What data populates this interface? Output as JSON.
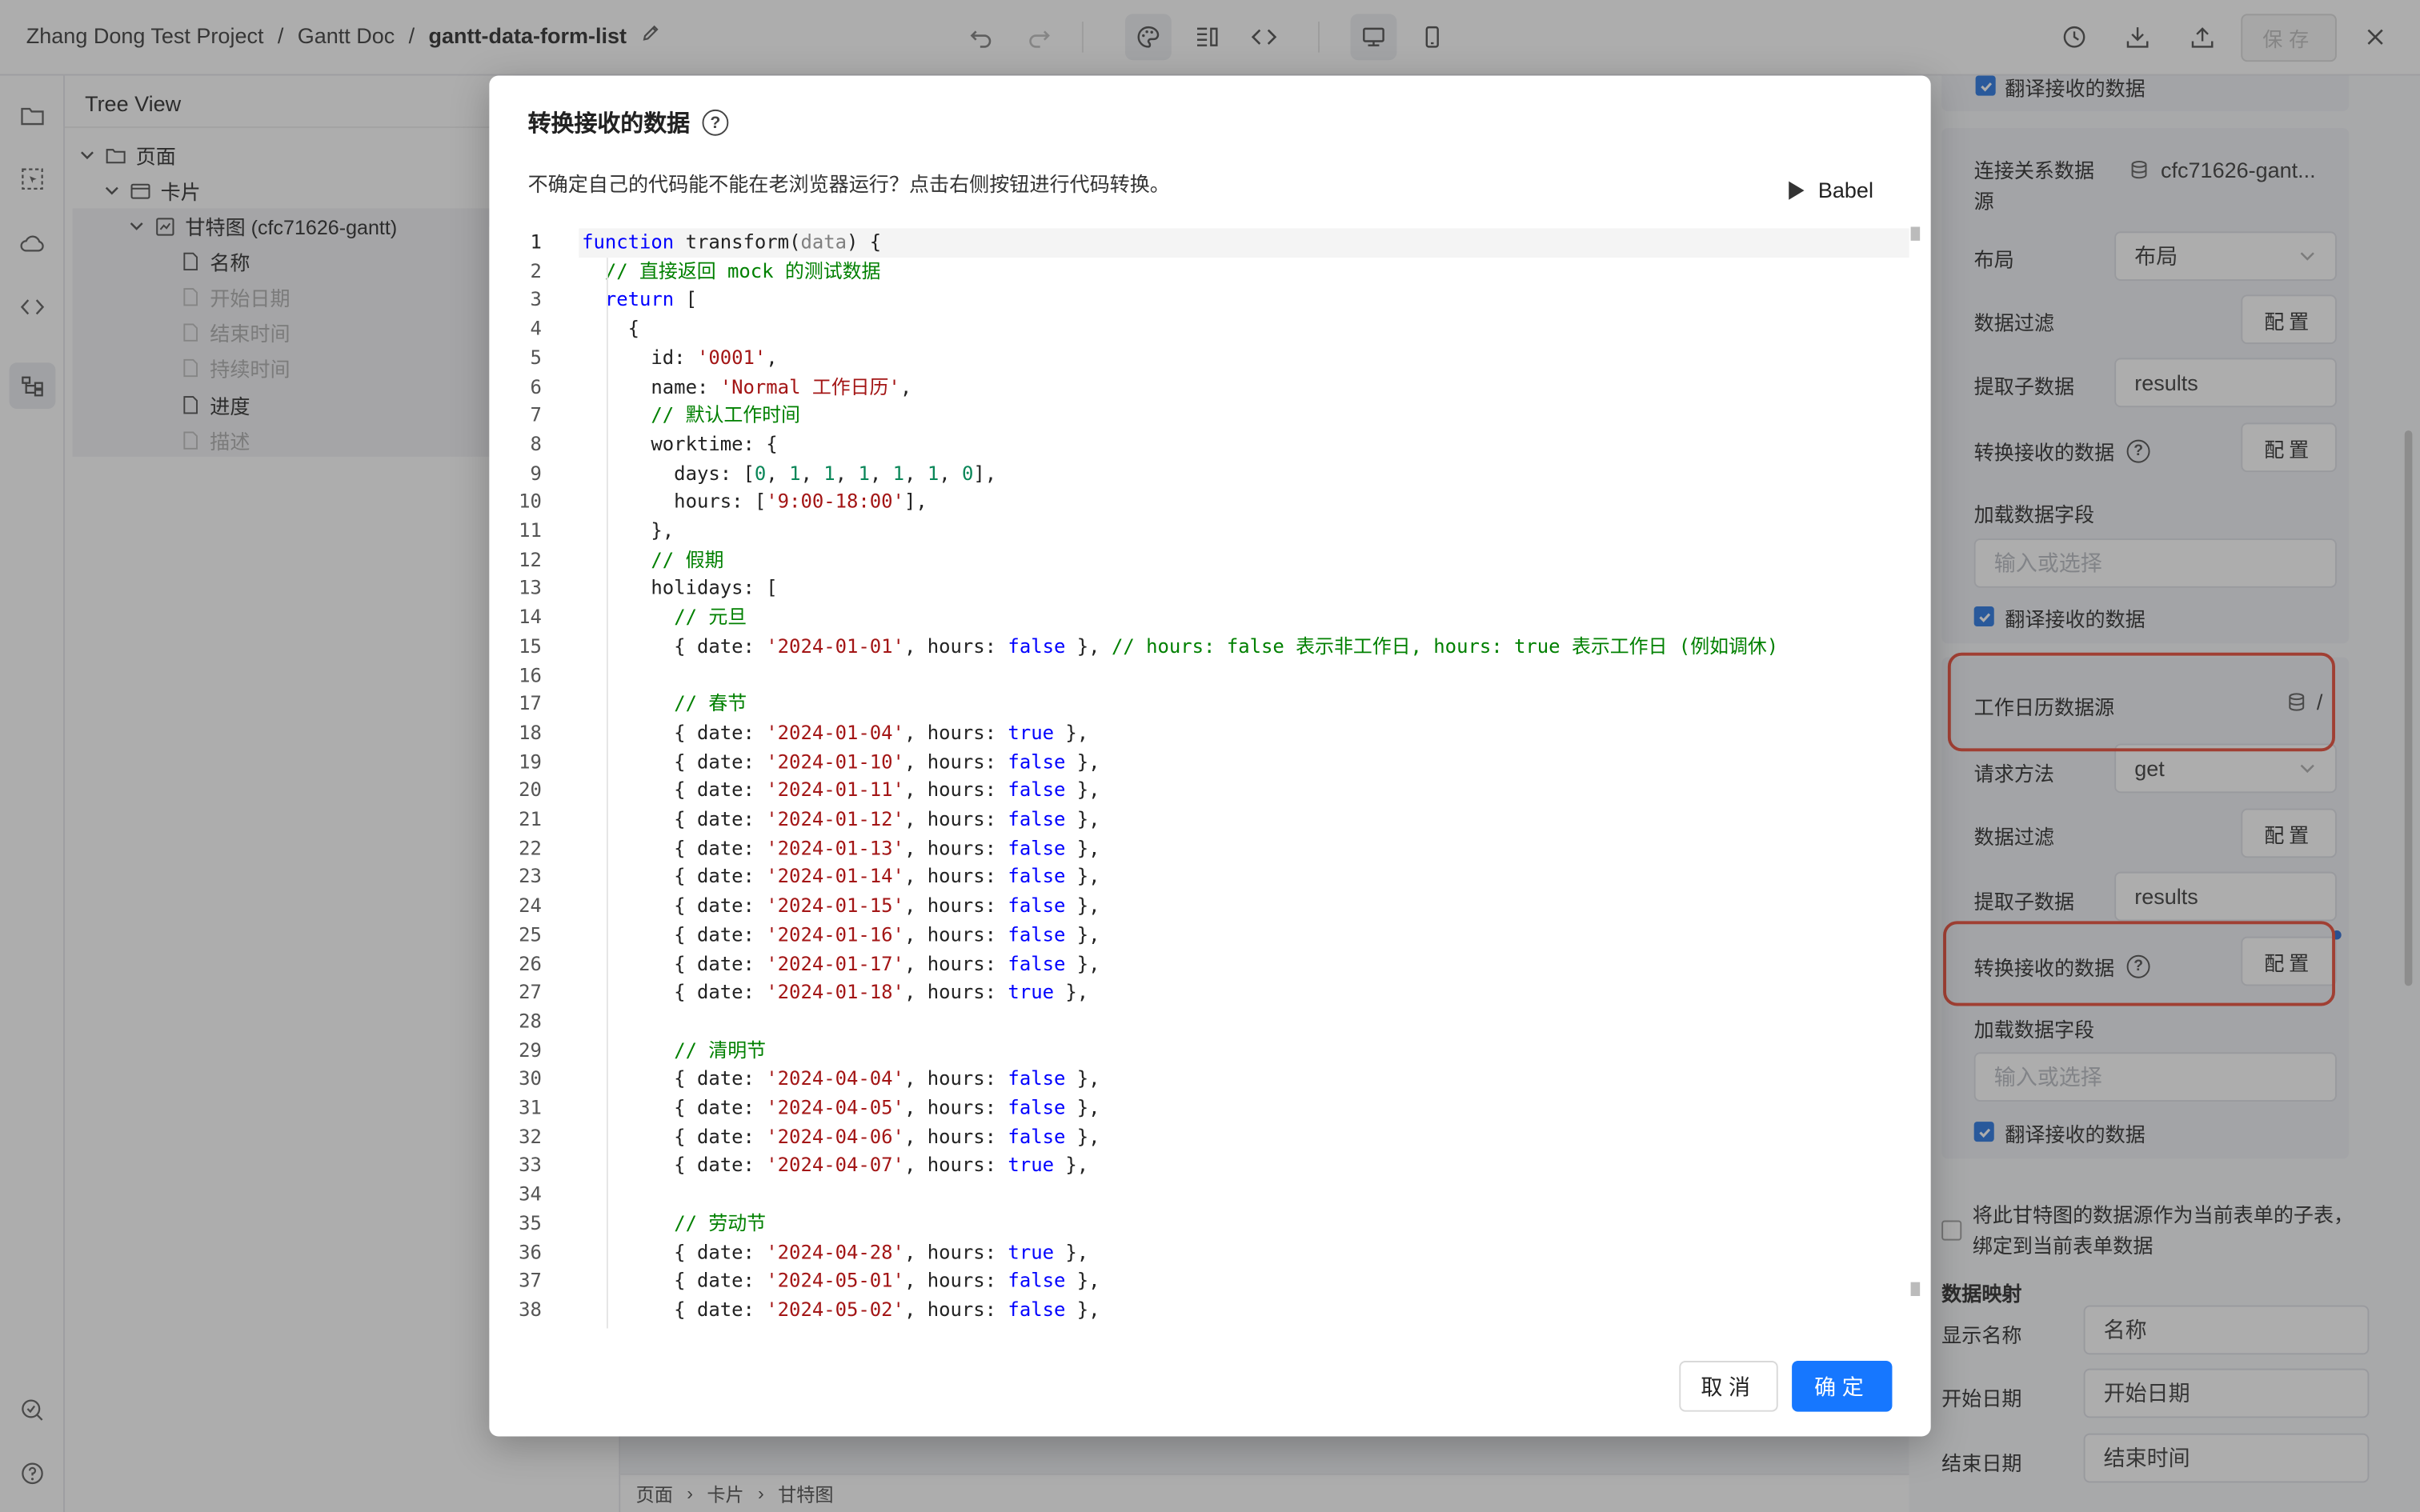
{
  "breadcrumb": {
    "project": "Zhang Dong Test Project",
    "sep1": "/",
    "doc": "Gantt Doc",
    "sep2": "/",
    "page": "gantt-data-form-list"
  },
  "toolbar": {
    "save_label": "保存"
  },
  "tree": {
    "title": "Tree View",
    "nodes": [
      {
        "label": "页面",
        "muted": false
      },
      {
        "label": "卡片",
        "muted": false
      },
      {
        "label": "甘特图 (cfc71626-gantt)",
        "muted": false
      },
      {
        "label": "名称",
        "muted": false
      },
      {
        "label": "开始日期",
        "muted": true
      },
      {
        "label": "结束时间",
        "muted": true
      },
      {
        "label": "持续时间",
        "muted": true
      },
      {
        "label": "进度",
        "muted": false
      },
      {
        "label": "描述",
        "muted": true
      }
    ]
  },
  "status_breadcrumb": [
    "页面",
    "卡片",
    "甘特图"
  ],
  "modal": {
    "title": "转换接收的数据",
    "description": "不确定自己的代码能不能在老浏览器运行？点击右侧按钮进行代码转换。",
    "babel_label": "Babel",
    "cancel_label": "取消",
    "ok_label": "确定",
    "code_lines": [
      "function transform(data) {",
      "  // 直接返回 mock 的测试数据",
      "  return [",
      "    {",
      "      id: '0001',",
      "      name: 'Normal 工作日历',",
      "      // 默认工作时间",
      "      worktime: {",
      "        days: [0, 1, 1, 1, 1, 1, 0],",
      "        hours: ['9:00-18:00'],",
      "      },",
      "      // 假期",
      "      holidays: [",
      "        // 元旦",
      "        { date: '2024-01-01', hours: false }, // hours: false 表示非工作日, hours: true 表示工作日 (例如调休)",
      "",
      "        // 春节",
      "        { date: '2024-01-04', hours: true },",
      "        { date: '2024-01-10', hours: false },",
      "        { date: '2024-01-11', hours: false },",
      "        { date: '2024-01-12', hours: false },",
      "        { date: '2024-01-13', hours: false },",
      "        { date: '2024-01-14', hours: false },",
      "        { date: '2024-01-15', hours: false },",
      "        { date: '2024-01-16', hours: false },",
      "        { date: '2024-01-17', hours: false },",
      "        { date: '2024-01-18', hours: true },",
      "",
      "        // 清明节",
      "        { date: '2024-04-04', hours: false },",
      "        { date: '2024-04-05', hours: false },",
      "        { date: '2024-04-06', hours: false },",
      "        { date: '2024-04-07', hours: true },",
      "",
      "        // 劳动节",
      "        { date: '2024-04-28', hours: true },",
      "        { date: '2024-05-01', hours: false },",
      "        { date: '2024-05-02', hours: false },"
    ]
  },
  "right_panel": {
    "translate_label": "翻译接收的数据",
    "relation_source_label": "连接关系数据源",
    "relation_source_value": "cfc71626-gant...",
    "layout_label": "布局",
    "layout_value": "布局",
    "filter_label": "数据过滤",
    "config_label": "配置",
    "extract_label": "提取子数据",
    "extract_value": "results",
    "transform_label": "转换接收的数据",
    "load_fields_label": "加载数据字段",
    "load_fields_placeholder": "输入或选择",
    "calendar_source_label": "工作日历数据源",
    "calendar_source_value": "/",
    "method_label": "请求方法",
    "method_value": "get",
    "subtable_label": "将此甘特图的数据源作为当前表单的子表，绑定到当前表单数据",
    "mapping_title": "数据映射",
    "mapping": [
      {
        "label": "显示名称",
        "value": "名称"
      },
      {
        "label": "开始日期",
        "value": "开始日期"
      },
      {
        "label": "结束日期",
        "value": "结束时间"
      }
    ]
  },
  "colors": {
    "accent": "#1677ff",
    "highlight": "#e8432d",
    "keyword": "#0000ff",
    "string": "#a31515",
    "number": "#098658",
    "comment": "#008000"
  }
}
